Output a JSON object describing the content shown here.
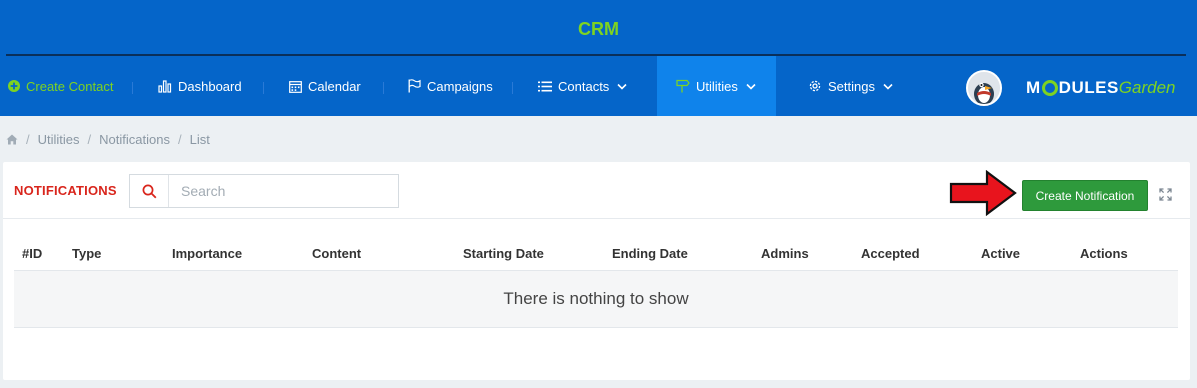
{
  "app": {
    "title": "CRM"
  },
  "nav": {
    "create_contact": "Create Contact",
    "dashboard": "Dashboard",
    "calendar": "Calendar",
    "campaigns": "Campaigns",
    "contacts": "Contacts",
    "utilities": "Utilities",
    "settings": "Settings"
  },
  "logo": {
    "part1": "M",
    "part2": "DULES",
    "part3": "Garden"
  },
  "breadcrumb": [
    "Utilities",
    "Notifications",
    "List"
  ],
  "panel": {
    "title": "NOTIFICATIONS",
    "search_placeholder": "Search",
    "create_button": "Create Notification"
  },
  "table": {
    "columns": [
      "#ID",
      "Type",
      "Importance",
      "Content",
      "Starting Date",
      "Ending Date",
      "Admins",
      "Accepted",
      "Active",
      "Actions"
    ],
    "empty_message": "There is nothing to show"
  },
  "colors": {
    "topbar": "#0565c9",
    "active_tab": "#0f83eb",
    "brand_green": "#7ed321",
    "title_red": "#d9251c",
    "button_green": "#2e9a3c"
  },
  "icons": [
    "plus-circle-icon",
    "bar-chart-icon",
    "calendar-icon",
    "flag-icon",
    "list-icon",
    "signpost-icon",
    "gear-icon",
    "chevron-down-icon",
    "home-icon",
    "search-icon",
    "arrow-right-icon",
    "expand-icon"
  ]
}
